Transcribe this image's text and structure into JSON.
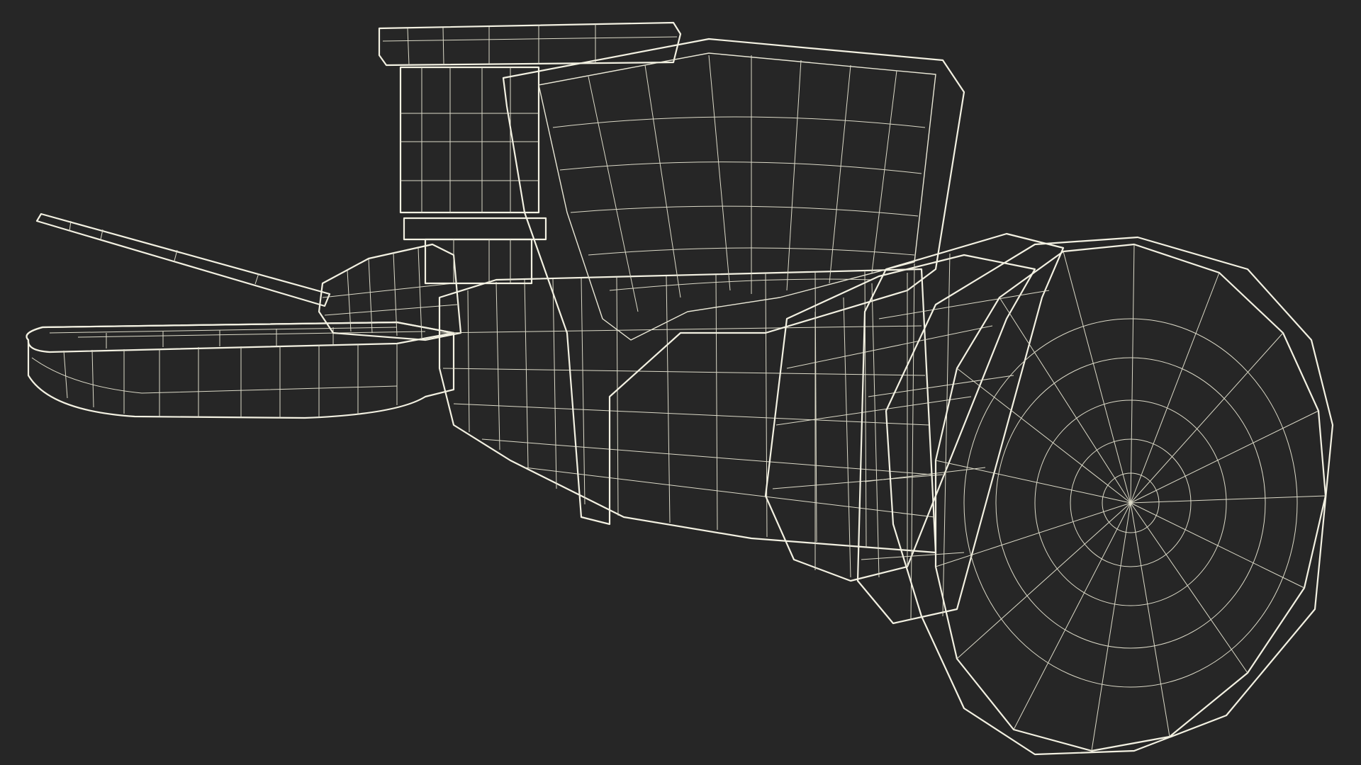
{
  "viewport": {
    "background_color": "#262626",
    "model_fill_color": "#6e6f63",
    "model_shadow_color": "#55564c",
    "model_highlight_color": "#7d7e71",
    "wire_color": "#e9e7d6"
  },
  "model": {
    "subject": "wireframe-valve-model",
    "render_mode": "wireframe-on-shaded"
  }
}
